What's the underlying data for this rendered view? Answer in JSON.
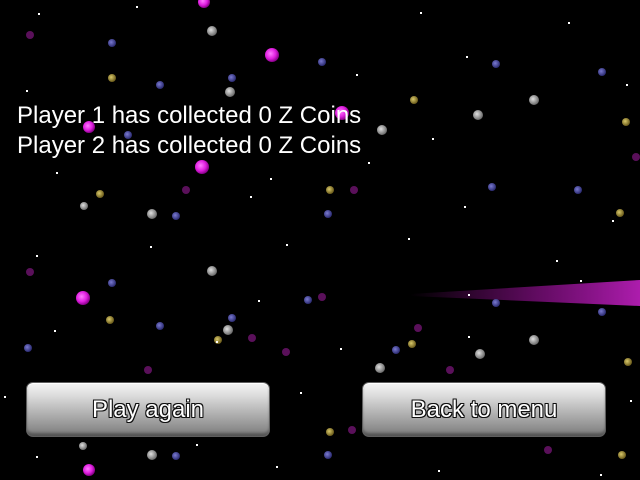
{
  "scores": {
    "player1_text": "Player 1 has collected 0 Z Coins",
    "player2_text": "Player 2 has collected 0 Z Coins"
  },
  "buttons": {
    "play_again_label": "Play again",
    "back_to_menu_label": "Back to menu"
  },
  "colors": {
    "background": "#000000",
    "text": "#ffffff",
    "star_magenta": "#e020e0",
    "star_blue": "#4a4aa0",
    "star_yellow": "#9a8a3a",
    "star_grey": "#9a9a9a",
    "comet_trail": "#b014b0"
  }
}
